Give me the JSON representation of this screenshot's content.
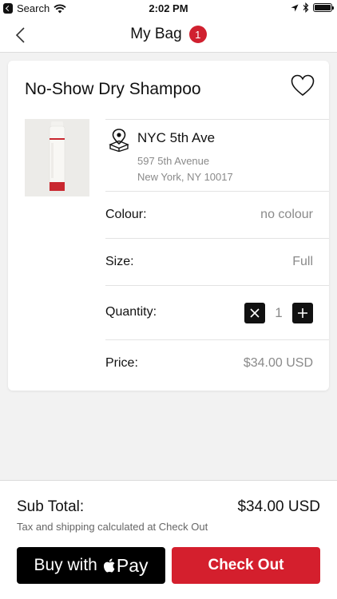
{
  "status_bar": {
    "back_app": "Search",
    "time": "2:02 PM"
  },
  "nav": {
    "title": "My Bag",
    "badge_count": "1"
  },
  "item": {
    "name": "No-Show Dry Shampoo",
    "store": {
      "name": "NYC 5th Ave",
      "address_line1": "597 5th Avenue",
      "address_line2": "New York, NY 10017"
    },
    "colour_label": "Colour:",
    "colour_value": "no colour",
    "size_label": "Size:",
    "size_value": "Full",
    "quantity_label": "Quantity:",
    "quantity_value": "1",
    "price_label": "Price:",
    "price_value": "$34.00 USD"
  },
  "footer": {
    "subtotal_label": "Sub Total:",
    "subtotal_value": "$34.00 USD",
    "tax_note": "Tax and shipping calculated at Check Out",
    "apple_pay_text": "Buy with",
    "apple_pay_word": "Pay",
    "checkout_label": "Check Out"
  },
  "colors": {
    "accent_red": "#d41f2d",
    "badge_red": "#d0202f",
    "text_primary": "#111111",
    "text_secondary": "#8a8a8a",
    "background": "#f2f2f2"
  },
  "icons": [
    "back-chevron-icon",
    "wifi-icon",
    "location-arrow-icon",
    "bluetooth-icon",
    "battery-icon",
    "heart-icon",
    "store-pin-icon",
    "remove-icon",
    "add-icon",
    "apple-logo-icon"
  ]
}
